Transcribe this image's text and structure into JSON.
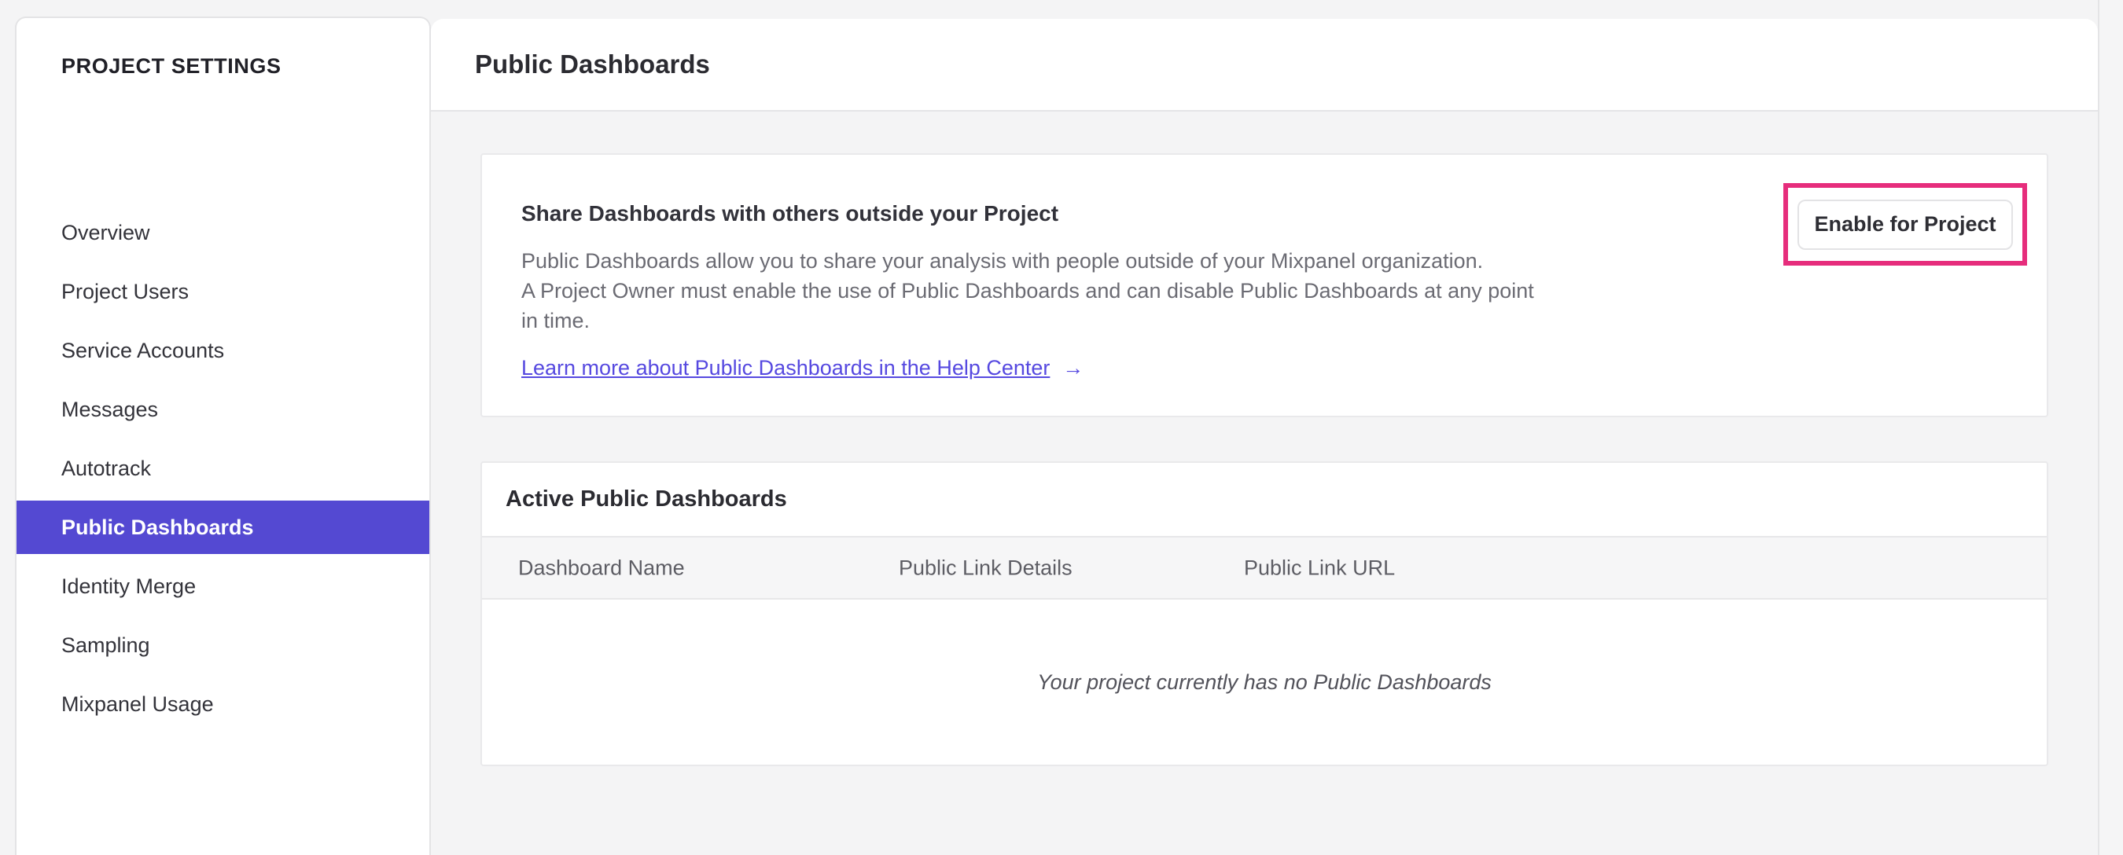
{
  "sidebar": {
    "title": "PROJECT SETTINGS",
    "items": [
      {
        "label": "Overview",
        "selected": false
      },
      {
        "label": "Project Users",
        "selected": false
      },
      {
        "label": "Service Accounts",
        "selected": false
      },
      {
        "label": "Messages",
        "selected": false
      },
      {
        "label": "Autotrack",
        "selected": false
      },
      {
        "label": "Public Dashboards",
        "selected": true
      },
      {
        "label": "Identity Merge",
        "selected": false
      },
      {
        "label": "Sampling",
        "selected": false
      },
      {
        "label": "Mixpanel Usage",
        "selected": false
      }
    ]
  },
  "header": {
    "title": "Public Dashboards"
  },
  "share_card": {
    "heading": "Share Dashboards with others outside your Project",
    "description_lines": {
      "line1": "Public Dashboards allow you to share your analysis with people outside of your Mixpanel organization.",
      "line2": "A Project Owner must enable the use of Public Dashboards and can disable Public Dashboards at any point",
      "line3": "in time."
    },
    "link_label": "Learn more about Public Dashboards in the Help Center",
    "link_arrow": "→",
    "enable_button_label": "Enable for Project"
  },
  "active_card": {
    "title": "Active Public Dashboards",
    "columns": [
      "Dashboard Name",
      "Public Link Details",
      "Public Link URL"
    ],
    "empty_message": "Your project currently has no Public Dashboards"
  },
  "colors": {
    "accent_purple": "#5449d2",
    "link_purple": "#5649e0",
    "highlight_pink": "#e62d7c",
    "page_background": "#f4f4f5"
  }
}
